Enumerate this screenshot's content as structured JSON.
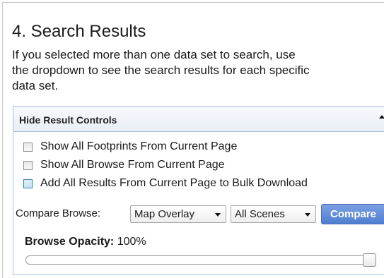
{
  "section": {
    "title": "4. Search Results",
    "instructions": [
      "If you selected more than one data set to search, use",
      "the dropdown to see the search results for each specific",
      "data set."
    ]
  },
  "controls": {
    "header_label": "Hide Result Controls",
    "collapse_icon": "triangle-up-icon",
    "options": [
      {
        "label": "Show All Footprints From Current Page",
        "checked": false
      },
      {
        "label": "Show All Browse From Current Page",
        "checked": false
      },
      {
        "label": "Add All Results From Current Page to Bulk Download",
        "checked": false
      }
    ],
    "compare": {
      "label": "Compare Browse:",
      "browse_select": {
        "value": "Map Overlay",
        "icon": "chevron-down-icon"
      },
      "scene_select": {
        "value": "All Scenes",
        "icon": "chevron-down-icon"
      },
      "button_label": "Compare"
    },
    "opacity": {
      "label": "Browse Opacity:",
      "value_text": "100%",
      "level": 1.0
    }
  },
  "colors": {
    "accent": "#4f7ed0",
    "panel_border": "#a9bfdc",
    "checkbox_highlight": "#c6e5f6"
  }
}
